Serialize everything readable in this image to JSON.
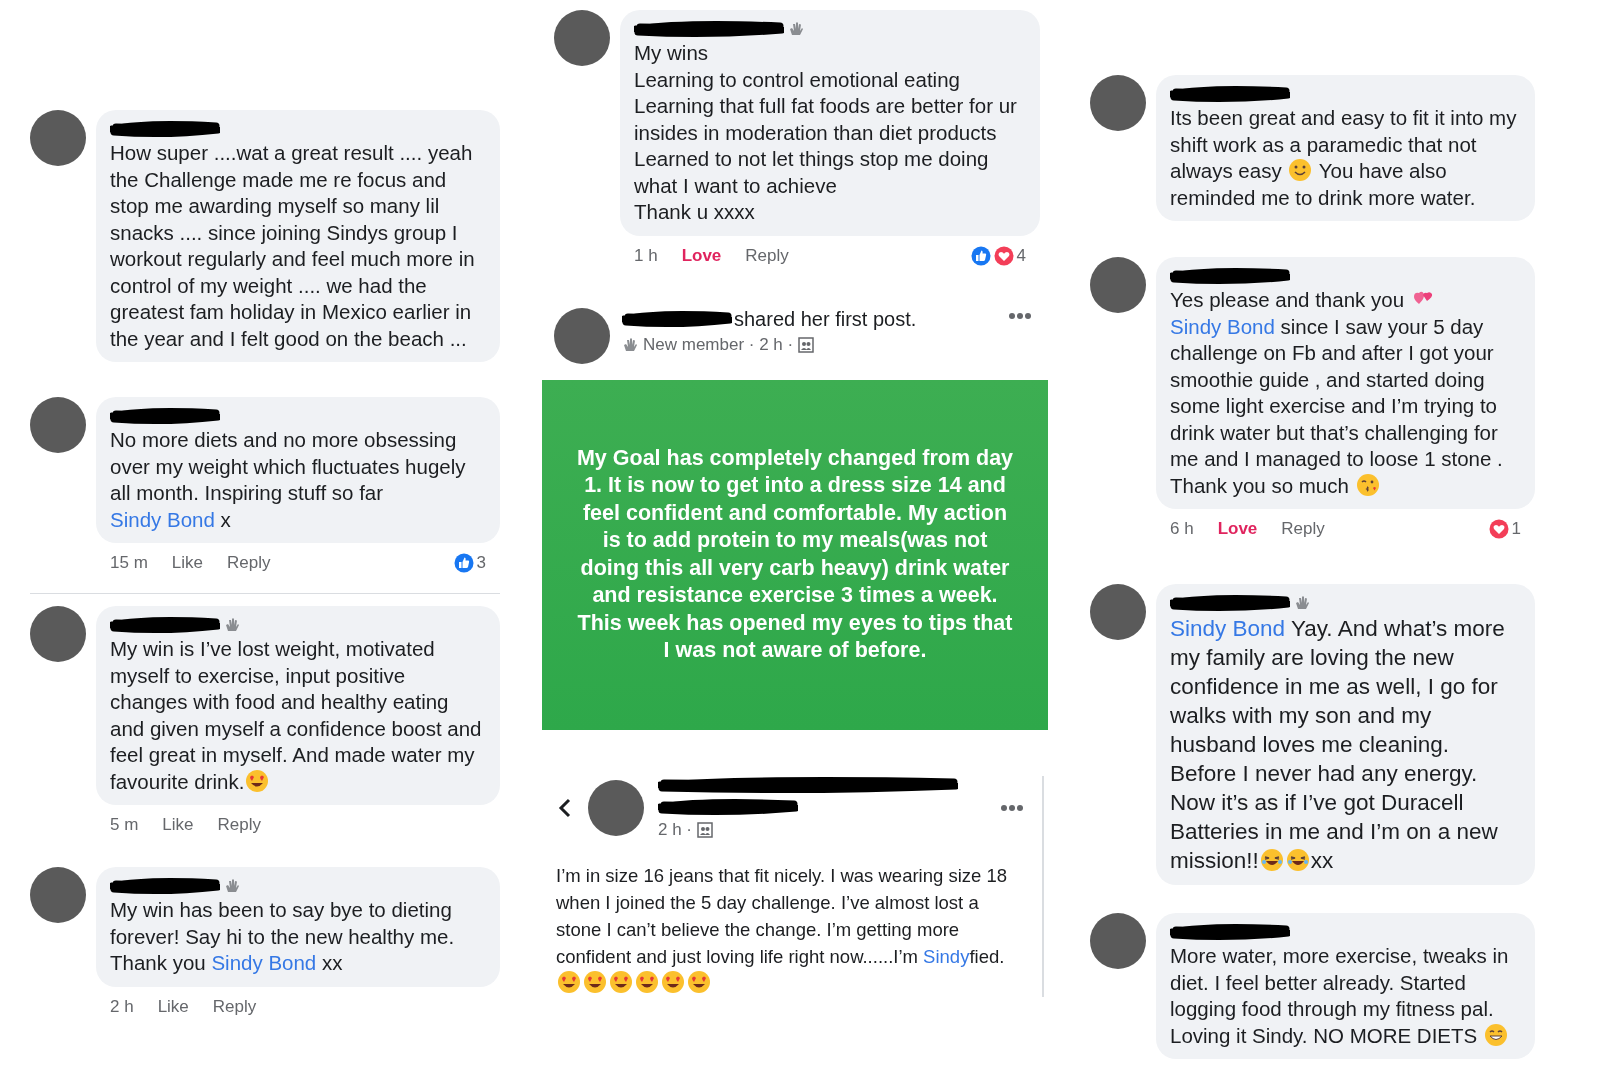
{
  "left_comments": [
    {
      "new_member": false,
      "paragraphs": [
        [
          {
            "kind": "text",
            "text": "How super ....wat a great result .... yeah the Challenge made me re focus and stop me awarding myself so many lil snacks .... since joining Sindys group I workout regularly and feel much more in control of my weight .... we had the greatest fam holiday in Mexico earlier in the year and I felt good on the beach ..."
          }
        ]
      ]
    },
    {
      "new_member": false,
      "paragraphs": [
        [
          {
            "kind": "text",
            "text": "No more diets and no more obsessing over my weight which fluctuates hugely all month. Inspiring stuff so far "
          },
          {
            "kind": "link",
            "text": "Sindy Bond"
          },
          {
            "kind": "text",
            "text": " x"
          }
        ]
      ],
      "footer": {
        "time": "15 m",
        "actions": [
          {
            "label": "Like",
            "reacted": false
          },
          {
            "label": "Reply",
            "reacted": false
          }
        ],
        "reactions": {
          "count": "3",
          "kinds": [
            {
              "kind": "like"
            }
          ]
        }
      }
    },
    {
      "new_member": true,
      "paragraphs": [
        [
          {
            "kind": "text",
            "text": "My win is I’ve lost weight, motivated myself to exercise, input positive changes with food and healthy eating and given myself a confidence boost and feel great in myself. And made water my favourite drink."
          },
          {
            "kind": "heart-eyes-emoji"
          }
        ]
      ],
      "footer": {
        "time": "5 m",
        "actions": [
          {
            "label": "Like",
            "reacted": false
          },
          {
            "label": "Reply",
            "reacted": false
          }
        ]
      }
    },
    {
      "new_member": true,
      "paragraphs": [
        [
          {
            "kind": "text",
            "text": "My win has been to say bye to dieting forever! Say hi to the new healthy me. Thank you "
          },
          {
            "kind": "link",
            "text": "Sindy Bond"
          },
          {
            "kind": "text",
            "text": " xx"
          }
        ]
      ],
      "footer": {
        "time": "2 h",
        "actions": [
          {
            "label": "Like",
            "reacted": false
          },
          {
            "label": "Reply",
            "reacted": false
          }
        ]
      }
    }
  ],
  "middle": {
    "comment": {
      "new_member": true,
      "paragraphs": [
        [
          {
            "kind": "text",
            "text": "My wins"
          }
        ],
        [
          {
            "kind": "text",
            "text": "Learning to control emotional eating"
          }
        ],
        [
          {
            "kind": "text",
            "text": "Learning that full fat foods are better for ur insides in moderation than diet products"
          }
        ],
        [
          {
            "kind": "text",
            "text": "Learned to not let things stop me doing what I want to achieve"
          }
        ],
        [
          {
            "kind": "text",
            "text": "Thank u xxxx"
          }
        ]
      ],
      "footer": {
        "time": "1 h",
        "actions": [
          {
            "label": "Love",
            "reacted": true
          },
          {
            "label": "Reply",
            "reacted": false
          }
        ],
        "reactions": {
          "count": "4",
          "kinds": [
            {
              "kind": "like"
            },
            {
              "kind": "love"
            }
          ]
        }
      }
    },
    "first_post": {
      "headline": "shared her first post.",
      "meta": "New member · 2 h ·",
      "card_text": "My Goal has completely changed from day 1. It is now to get into a dress size 14 and feel confident and comfortable. My action is to add protein to my meals(was not doing this all very carb heavy) drink water and resistance exercise 3 times a week. This week has opened my eyes to tips that I was not aware of before."
    },
    "second_post": {
      "time": "2 h ·",
      "body": [
        {
          "kind": "text",
          "text": "I’m in size 16 jeans that fit nicely. I was wearing size 18 when I joined the 5 day challenge. I’ve almost lost a stone I can’t believe the change. I’m getting more confident and just loving life right now......I’m "
        },
        {
          "kind": "link",
          "text": "Sindy"
        },
        {
          "kind": "text",
          "text": "fied."
        },
        {
          "kind": "heart-eyes-emoji"
        },
        {
          "kind": "heart-eyes-emoji"
        },
        {
          "kind": "heart-eyes-emoji"
        },
        {
          "kind": "heart-eyes-emoji"
        },
        {
          "kind": "heart-eyes-emoji"
        },
        {
          "kind": "heart-eyes-emoji"
        }
      ]
    }
  },
  "right_comments": [
    {
      "new_member": false,
      "paragraphs": [
        [
          {
            "kind": "text",
            "text": "Its been great and easy to fit it into my shift work as a paramedic that not always easy "
          },
          {
            "kind": "smile-emoji"
          },
          {
            "kind": "text",
            "text": " You have also reminded me to drink more water."
          }
        ]
      ]
    },
    {
      "new_member": false,
      "paragraphs": [
        [
          {
            "kind": "text",
            "text": "Yes please and thank you "
          },
          {
            "kind": "hearts-emoji"
          }
        ],
        [
          {
            "kind": "link",
            "text": "Sindy Bond"
          },
          {
            "kind": "text",
            "text": " since I saw your 5 day challenge on Fb and after I got your smoothie guide  , and started doing some light exercise and I’m trying to drink water but that’s challenging for me and I managed to loose 1 stone ."
          }
        ],
        [
          {
            "kind": "text",
            "text": "Thank you so much "
          },
          {
            "kind": "kiss-emoji"
          }
        ]
      ],
      "footer": {
        "time": "6 h",
        "actions": [
          {
            "label": "Love",
            "reacted": true
          },
          {
            "label": "Reply",
            "reacted": false
          }
        ],
        "reactions": {
          "count": "1",
          "kinds": [
            {
              "kind": "love"
            }
          ]
        }
      }
    },
    {
      "new_member": true,
      "paragraphs": [
        [
          {
            "kind": "link",
            "text": "Sindy Bond"
          },
          {
            "kind": "text",
            "text": " Yay. And what’s more my family are loving the new confidence in me as well, I go for walks with my son and my husband loves me cleaning. Before I never had any energy. Now it’s as if I’ve got Duracell Batteries in me and I’m on a new mission!!"
          },
          {
            "kind": "laugh-emoji"
          },
          {
            "kind": "laugh-emoji"
          },
          {
            "kind": "text",
            "text": "xx"
          }
        ]
      ]
    },
    {
      "new_member": false,
      "paragraphs": [
        [
          {
            "kind": "text",
            "text": "More water, more exercise, tweaks in diet. I feel better already. Started logging food through my fitness pal."
          }
        ],
        [
          {
            "kind": "text",
            "text": "Loving it Sindy. NO MORE DIETS "
          },
          {
            "kind": "grin-emoji"
          }
        ]
      ]
    }
  ]
}
